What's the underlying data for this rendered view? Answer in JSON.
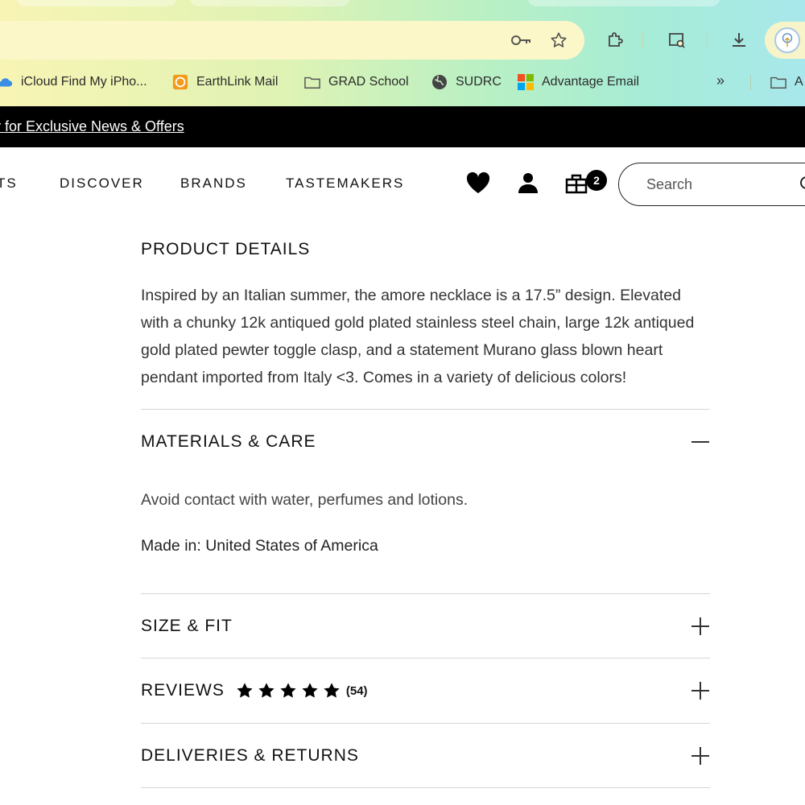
{
  "browser": {
    "bookmarks": [
      {
        "label": "iCloud Find My iPho...",
        "icon": "cloud-icon"
      },
      {
        "label": "EarthLink Mail",
        "icon": "earthlink-icon"
      },
      {
        "label": "GRAD School",
        "icon": "folder-icon"
      },
      {
        "label": "SUDRC",
        "icon": "globe-icon"
      },
      {
        "label": "Advantage Email",
        "icon": "microsoft-icon"
      }
    ],
    "bookmarks_overflow": "»",
    "bookmark_folder_partial": "A",
    "toolbar_icons": [
      "key-icon",
      "star-icon",
      "extensions-icon",
      "tab-search-icon",
      "download-icon",
      "profile-icon"
    ]
  },
  "promo": {
    "text": "y for Exclusive News & Offers"
  },
  "nav": {
    "items": [
      "TS",
      "DISCOVER",
      "BRANDS",
      "TASTEMAKERS"
    ],
    "cart_count": "2",
    "search_placeholder": "Search"
  },
  "product": {
    "details_heading": "PRODUCT DETAILS",
    "description": "Inspired by an Italian summer, the amore necklace is a 17.5” design. Elevated with a chunky 12k antiqued gold plated stainless steel chain, large 12k antiqued gold plated pewter toggle clasp, and a statement Murano glass blown heart pendant imported from Italy <3. Comes in a variety of delicious colors!"
  },
  "accordions": {
    "materials": {
      "label": "MATERIALS & CARE",
      "state": "expanded",
      "care": "Avoid contact with water, perfumes and lotions.",
      "made_in": "Made in: United States of America"
    },
    "size": {
      "label": "SIZE & FIT",
      "state": "collapsed"
    },
    "reviews": {
      "label": "REVIEWS",
      "rating": 5,
      "count": "(54)",
      "state": "collapsed"
    },
    "deliveries": {
      "label": "DELIVERIES & RETURNS",
      "state": "collapsed"
    }
  }
}
